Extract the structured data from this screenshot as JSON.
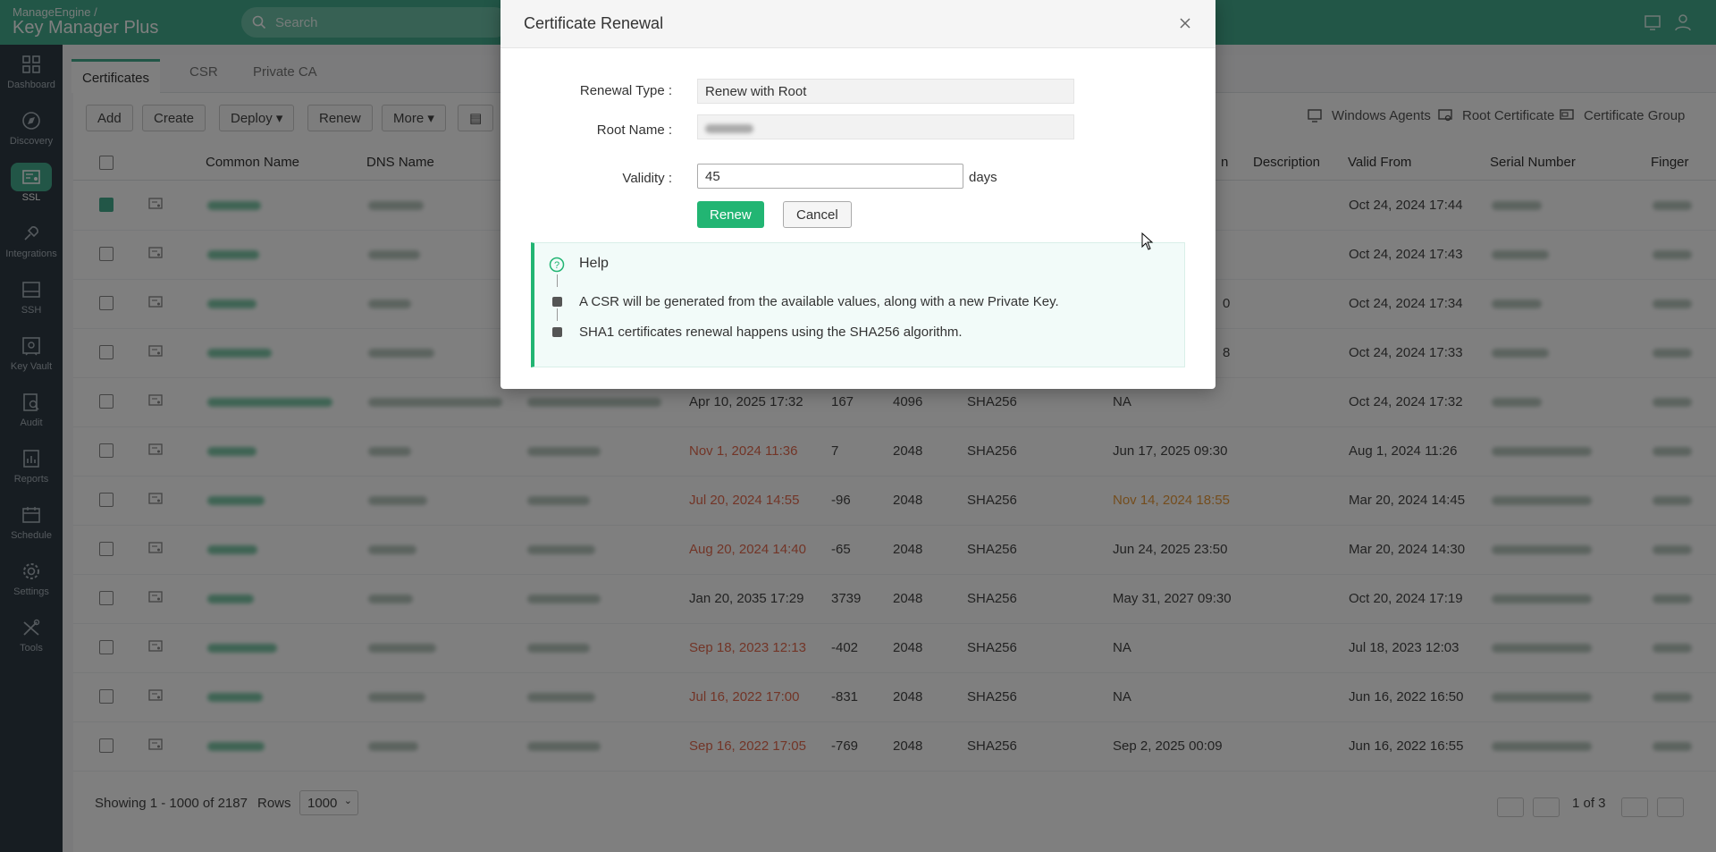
{
  "app": {
    "brand_top": "ManageEngine /",
    "brand_name": "Key Manager Plus"
  },
  "header": {
    "search_placeholder": "Search"
  },
  "leftnav": [
    {
      "label": "Dashboard",
      "icon": "dashboard-icon"
    },
    {
      "label": "Discovery",
      "icon": "compass-icon"
    },
    {
      "label": "SSL",
      "icon": "ssl-certificate-icon",
      "active": true
    },
    {
      "label": "Integrations",
      "icon": "integrations-icon"
    },
    {
      "label": "SSH",
      "icon": "ssh-terminal-icon"
    },
    {
      "label": "Key Vault",
      "icon": "key-vault-icon"
    },
    {
      "label": "Audit",
      "icon": "audit-icon"
    },
    {
      "label": "Reports",
      "icon": "reports-icon"
    },
    {
      "label": "Schedule",
      "icon": "calendar-icon"
    },
    {
      "label": "Settings",
      "icon": "gear-icon"
    },
    {
      "label": "Tools",
      "icon": "tools-icon"
    }
  ],
  "tabs": [
    "Certificates",
    "CSR",
    "Private CA"
  ],
  "toolbar": {
    "add": "Add",
    "create": "Create",
    "deploy": "Deploy",
    "renew": "Renew",
    "more": "More"
  },
  "right_links": {
    "windows_agents": "Windows Agents",
    "root_certificate": "Root Certificate",
    "certificate_group": "Certificate Group"
  },
  "columns": [
    "Common Name",
    "DNS Name",
    "n",
    "Description",
    "Valid From",
    "Serial Number",
    "Finger"
  ],
  "rows": [
    {
      "expiry": "",
      "days": "",
      "key": "",
      "algo": "",
      "renewal": "",
      "valid_from": "Oct 24, 2024 17:44",
      "checked": true
    },
    {
      "expiry": "",
      "days": "",
      "key": "",
      "algo": "",
      "renewal": "",
      "valid_from": "Oct 24, 2024 17:43"
    },
    {
      "expiry": "",
      "days": "",
      "key": "",
      "algo": "",
      "renewal": "0",
      "valid_from": "Oct 24, 2024 17:34"
    },
    {
      "expiry": "",
      "days": "",
      "key": "",
      "algo": "",
      "renewal": "8",
      "valid_from": "Oct 24, 2024 17:33"
    },
    {
      "expiry": "Apr 10, 2025 17:32",
      "days": "167",
      "key": "4096",
      "algo": "SHA256",
      "renewal": "NA",
      "valid_from": "Oct 24, 2024 17:32"
    },
    {
      "expiry": "Nov 1, 2024 11:36",
      "expiry_red": true,
      "days": "7",
      "key": "2048",
      "algo": "SHA256",
      "renewal": "Jun 17, 2025 09:30",
      "valid_from": "Aug 1, 2024 11:26"
    },
    {
      "expiry": "Jul 20, 2024 14:55",
      "expiry_red": true,
      "days": "-96",
      "key": "2048",
      "algo": "SHA256",
      "renewal": "Nov 14, 2024 18:55",
      "renewal_orange": true,
      "valid_from": "Mar 20, 2024 14:45"
    },
    {
      "expiry": "Aug 20, 2024 14:40",
      "expiry_red": true,
      "days": "-65",
      "key": "2048",
      "algo": "SHA256",
      "renewal": "Jun 24, 2025 23:50",
      "valid_from": "Mar 20, 2024 14:30"
    },
    {
      "expiry": "Jan 20, 2035 17:29",
      "days": "3739",
      "key": "2048",
      "algo": "SHA256",
      "renewal": "May 31, 2027 09:30",
      "valid_from": "Oct 20, 2024 17:19"
    },
    {
      "expiry": "Sep 18, 2023 12:13",
      "expiry_red": true,
      "days": "-402",
      "key": "2048",
      "algo": "SHA256",
      "renewal": "NA",
      "valid_from": "Jul 18, 2023 12:03"
    },
    {
      "expiry": "Jul 16, 2022 17:00",
      "expiry_red": true,
      "days": "-831",
      "key": "2048",
      "algo": "SHA256",
      "renewal": "NA",
      "valid_from": "Jun 16, 2022 16:50"
    },
    {
      "expiry": "Sep 16, 2022 17:05",
      "expiry_red": true,
      "days": "-769",
      "key": "2048",
      "algo": "SHA256",
      "renewal": "Sep 2, 2025 00:09",
      "valid_from": "Jun 16, 2022 16:55"
    }
  ],
  "footer": {
    "showing": "Showing 1 - 1000 of 2187",
    "rows_label": "Rows",
    "rows_value": "1000",
    "page": "1 of 3"
  },
  "modal": {
    "title": "Certificate Renewal",
    "renewal_type_label": "Renewal Type :",
    "renewal_type_value": "Renew with Root",
    "root_name_label": "Root Name :",
    "validity_label": "Validity :",
    "validity_value": "45",
    "validity_unit": "days",
    "renew_button": "Renew",
    "cancel_button": "Cancel",
    "help_title": "Help",
    "help_items": [
      "A CSR will be generated from the available values, along with a new Private Key.",
      "SHA1 certificates renewal happens using the SHA256 algorithm."
    ]
  },
  "colors": {
    "brand": "#45ad8e",
    "primary_button": "#22b573",
    "expired_text": "#e46a4f"
  }
}
